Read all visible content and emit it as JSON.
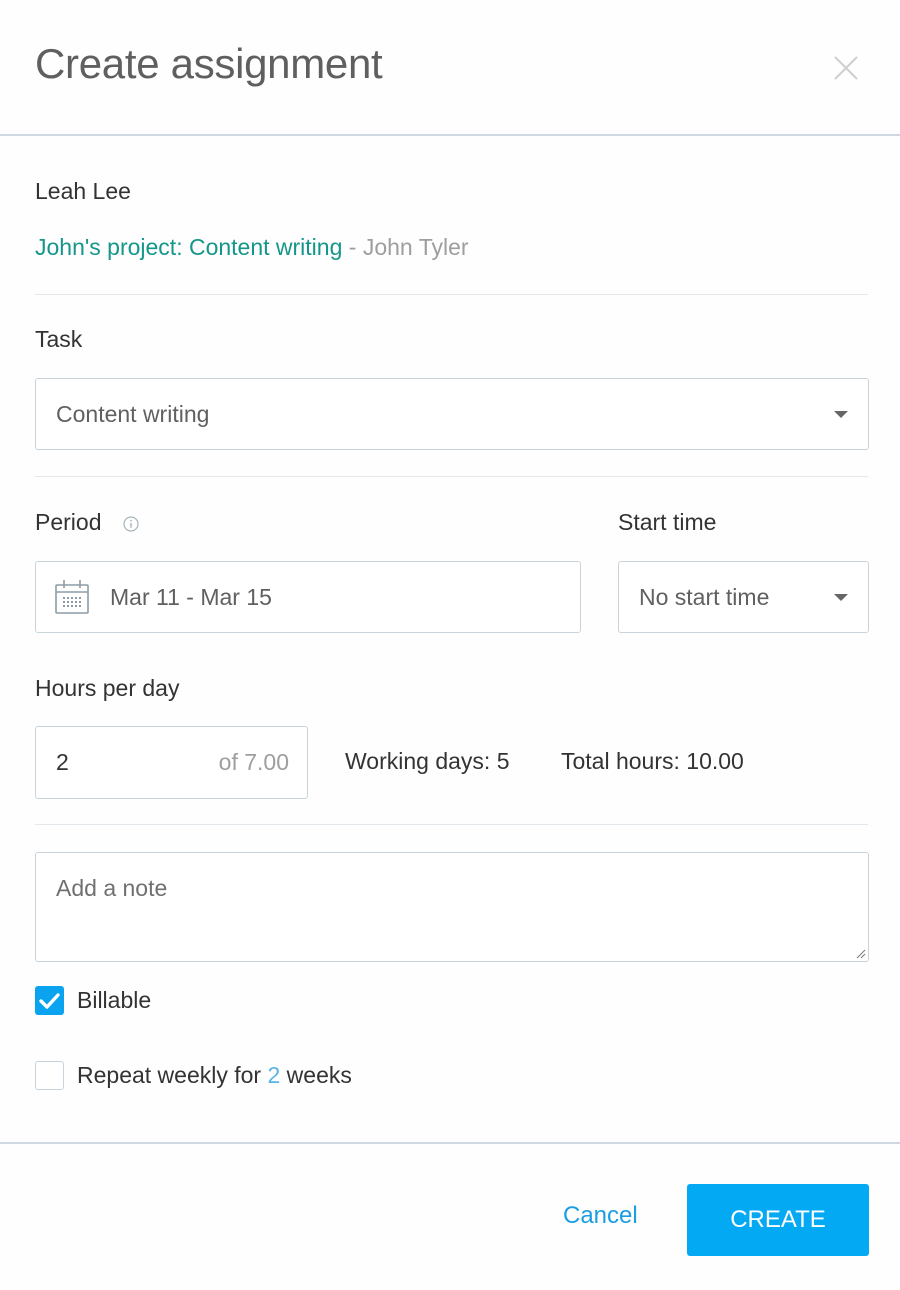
{
  "header": {
    "title": "Create assignment",
    "close_icon": "close-icon"
  },
  "assignment": {
    "person_name": "Leah Lee",
    "project_name": "John's project: Content writing",
    "separator": " - ",
    "project_owner": "John Tyler"
  },
  "task": {
    "label": "Task",
    "selected": "Content writing"
  },
  "period": {
    "label": "Period",
    "info_icon": "info-icon",
    "calendar_icon": "calendar-icon",
    "value": "Mar 11 - Mar 15"
  },
  "start_time": {
    "label": "Start time",
    "selected": "No start time"
  },
  "hours": {
    "label": "Hours per day",
    "value": "2",
    "of_text": "of 7.00",
    "working_days": "Working days: 5",
    "total_hours": "Total hours: 10.00"
  },
  "note": {
    "placeholder": "Add a note",
    "value": ""
  },
  "billable": {
    "label": "Billable",
    "checked": true
  },
  "repeat": {
    "label_before": "Repeat weekly for ",
    "weeks": "2",
    "label_after": " weeks",
    "checked": false
  },
  "footer": {
    "cancel_label": "Cancel",
    "create_label": "CREATE"
  },
  "colors": {
    "accent": "#04a9f4",
    "project_link": "#14968a",
    "border": "#c9d3da"
  }
}
